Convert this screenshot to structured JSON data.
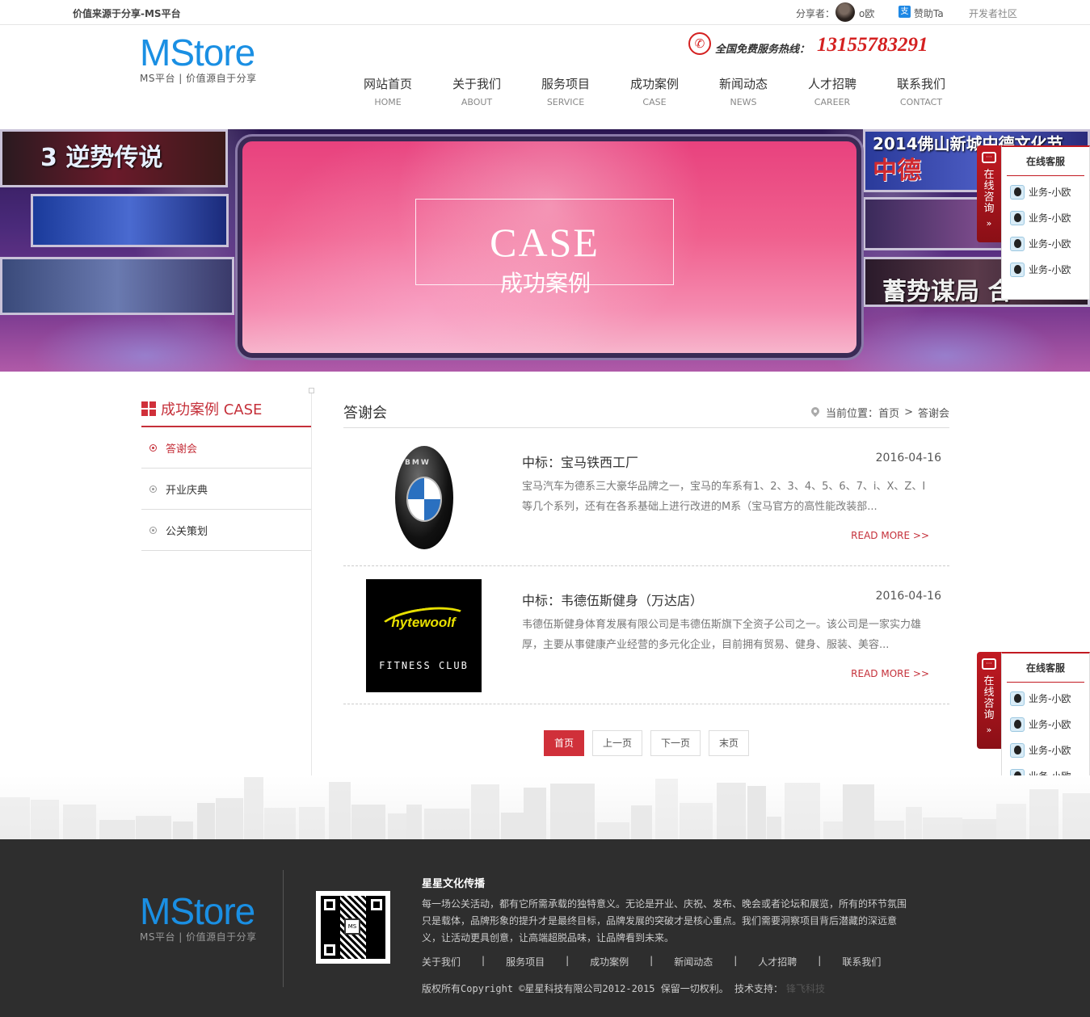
{
  "topbar": {
    "tagline": "价值来源于分享-MS平台",
    "share_label": "分享者：",
    "share_user": "o欧",
    "like_label": "赞助Ta",
    "dev_link": "开发者社区"
  },
  "header": {
    "logo_text": "MStore",
    "logo_sub": "MS平台 | 价值源自于分享",
    "hotline_label": "全国免费服务热线：",
    "hotline_number": "13155783291"
  },
  "nav": [
    {
      "cn": "网站首页",
      "en": "HOME"
    },
    {
      "cn": "关于我们",
      "en": "ABOUT"
    },
    {
      "cn": "服务项目",
      "en": "SERVICE"
    },
    {
      "cn": "成功案例",
      "en": "CASE"
    },
    {
      "cn": "新闻动态",
      "en": "NEWS"
    },
    {
      "cn": "人才招聘",
      "en": "CAREER"
    },
    {
      "cn": "联系我们",
      "en": "CONTACT"
    }
  ],
  "banner": {
    "title_en": "CASE",
    "title_cn": "成功案例",
    "screen_texts": [
      "3 逆势传说",
      "2014佛山新城中德文化节",
      "中德",
      "蓄势谋局 合"
    ]
  },
  "kefu": {
    "tab_label": [
      "在",
      "线",
      "咨",
      "询"
    ],
    "tab_arrow": "»",
    "title": "在线客服",
    "items": [
      "业务-小欧",
      "业务-小欧",
      "业务-小欧",
      "业务-小欧"
    ]
  },
  "sidebar": {
    "title": "成功案例 CASE",
    "items": [
      {
        "label": "答谢会",
        "active": true
      },
      {
        "label": "开业庆典",
        "active": false
      },
      {
        "label": "公关策划",
        "active": false
      }
    ]
  },
  "main": {
    "title": "答谢会",
    "location_label": "当前位置：",
    "crumb_home": "首页",
    "crumb_sep": ">",
    "crumb_current": "答谢会",
    "cases": [
      {
        "title": "中标：宝马铁西工厂",
        "date": "2016-04-16",
        "desc": "宝马汽车为德系三大豪华品牌之一，宝马的车系有1、2、3、4、5、6、7、i、X、Z、I等几个系列，还有在各系基础上进行改进的M系（宝马官方的高性能改装部...",
        "more": "READ MORE >>",
        "logo_text": "BMW"
      },
      {
        "title": "中标：韦德伍斯健身（万达店）",
        "date": "2016-04-16",
        "desc": "韦德伍斯健身体育发展有限公司是韦德伍斯旗下全资子公司之一。该公司是一家实力雄厚，主要从事健康产业经营的多元化企业，目前拥有贸易、健身、服装、美容...",
        "more": "READ MORE >>",
        "logo_text": "hytewoolf",
        "logo_sub": "FITNESS CLUB"
      }
    ],
    "pager": [
      "首页",
      "上一页",
      "下一页",
      "末页"
    ]
  },
  "footer": {
    "logo_text": "MStore",
    "logo_sub": "MS平台 | 价值源自于分享",
    "company": "星星文化传播",
    "about": "每一场公关活动，都有它所需承载的独特意义。无论是开业、庆祝、发布、晚会或者论坛和展览，所有的环节氛围只是载体，品牌形象的提升才是最终目标，品牌发展的突破才是核心重点。我们需要洞察项目背后潜藏的深远意义，让活动更具创意，让高端超脱品味，让品牌看到未来。",
    "links": [
      "关于我们",
      "服务项目",
      "成功案例",
      "新闻动态",
      "人才招聘",
      "联系我们"
    ],
    "link_sep": "|",
    "copyright": "版权所有Copyright ©星星科技有限公司2012-2015 保留一切权利。 技术支持：",
    "tech": "锋飞科技",
    "qr_mark": "MS"
  }
}
